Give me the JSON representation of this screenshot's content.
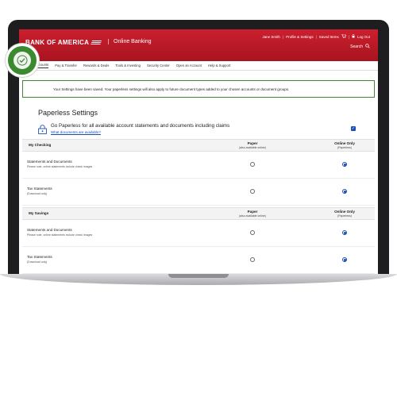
{
  "header": {
    "brand": "BANK OF AMERICA",
    "product": "Online Banking",
    "user": "Jane Smith",
    "profile": "Profile & Settings",
    "saved": "Saved Items",
    "logout": "Log Out",
    "search": "Search"
  },
  "nav": [
    "Accounts",
    "Pay & Transfer",
    "Rewards & Deals",
    "Tools & Investing",
    "Security Center",
    "Open an Account",
    "Help & Support"
  ],
  "alert": {
    "message": "Your Settings have been saved. Your paperless settings will also apply to future document types added to your chosen accounts or document groups."
  },
  "page": {
    "title": "Paperless Settings",
    "global_text": "Go Paperless for all available account statements and documents including claims",
    "global_link": "What documents are available?",
    "global_checked": true
  },
  "columns": {
    "paper": "Paper",
    "paper_sub": "(also available online)",
    "online": "Online Only",
    "online_sub": "(Paperless)"
  },
  "sections": [
    {
      "name": "My Checking",
      "rows": [
        {
          "label": "Statements and Documents",
          "note": "Please note, online statements include check images",
          "selected": "online"
        },
        {
          "label": "Tax Statements",
          "note": "(Download only)",
          "selected": "online"
        }
      ]
    },
    {
      "name": "My Savings",
      "rows": [
        {
          "label": "Statements and Documents",
          "note": "Please note, online statements include check images",
          "selected": "online"
        },
        {
          "label": "Tax Statements",
          "note": "(Download only)",
          "selected": "online"
        }
      ]
    }
  ],
  "colors": {
    "brand_red": "#cc1f2f",
    "success_green": "#3a8a2e",
    "link_blue": "#1a4eb6"
  },
  "icons": [
    "check-icon",
    "lock-icon",
    "cart-icon",
    "search-icon",
    "logout-icon"
  ]
}
